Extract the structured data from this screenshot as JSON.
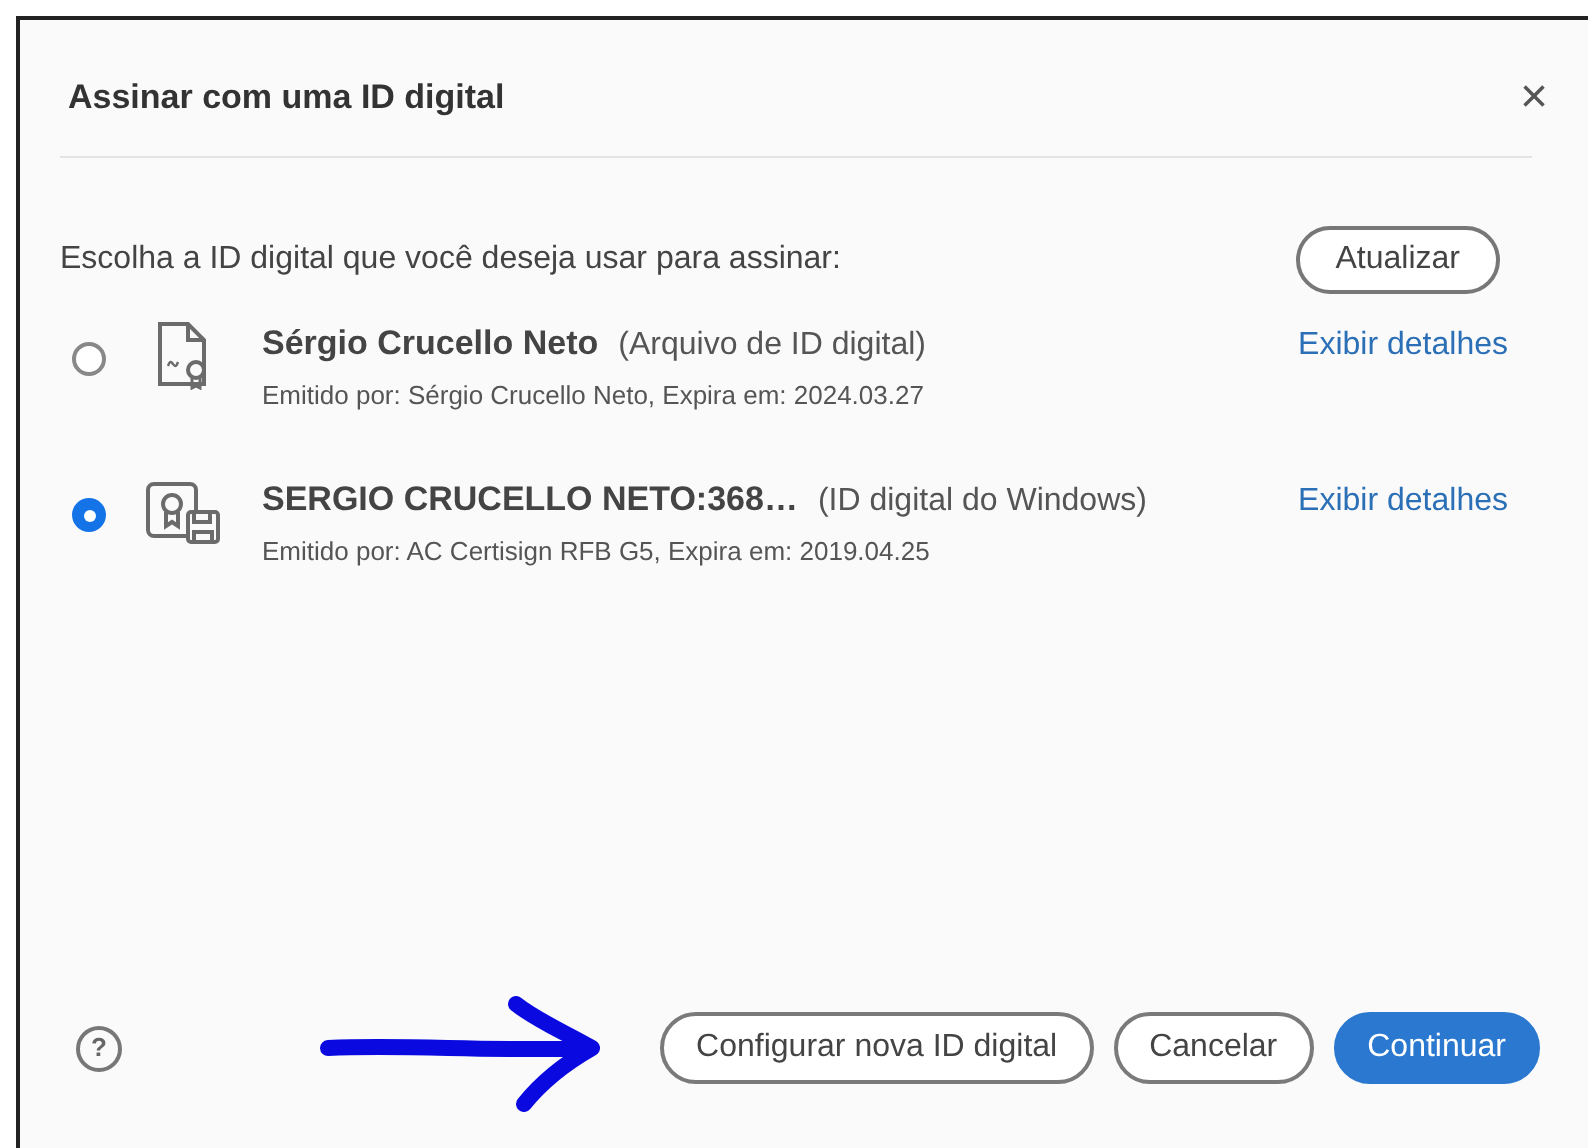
{
  "dialog": {
    "title": "Assinar com uma ID digital",
    "close": "×"
  },
  "prompt": "Escolha a ID digital que você deseja usar para assinar:",
  "refresh_button": "Atualizar",
  "ids": [
    {
      "kind": "file",
      "selected": false,
      "name": "Sérgio Crucello Neto",
      "type": "(Arquivo de ID digital)",
      "details": "Emitido por: Sérgio Crucello Neto, Expira em: 2024.03.27",
      "link": "Exibir detalhes"
    },
    {
      "kind": "windows",
      "selected": true,
      "name": "SERGIO CRUCELLO NETO:368…",
      "type": "(ID digital do Windows)",
      "details": "Emitido por: AC Certisign RFB G5, Expira em: 2019.04.25",
      "link": "Exibir detalhes"
    }
  ],
  "footer": {
    "help": "?",
    "buttons": [
      {
        "label": "Configurar nova ID digital",
        "kind": "secondary"
      },
      {
        "label": "Cancelar",
        "kind": "secondary"
      },
      {
        "label": "Continuar",
        "kind": "primary"
      }
    ]
  }
}
